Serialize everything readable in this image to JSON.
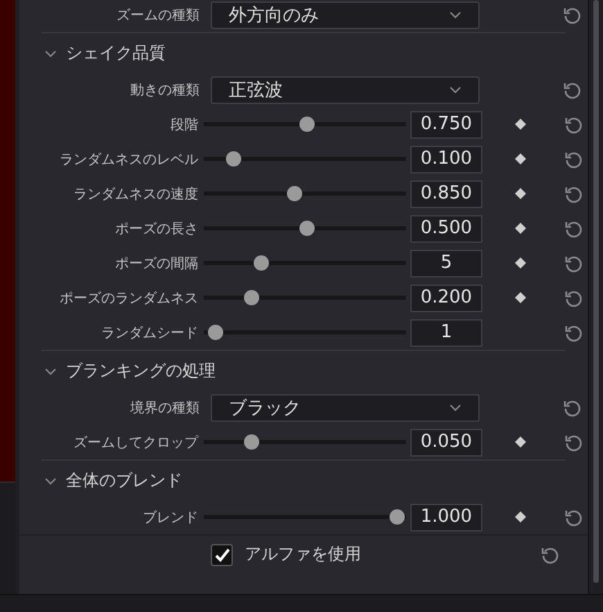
{
  "top_row": {
    "kind": "dropdown",
    "label": "ズームの種類",
    "value": "外方向のみ"
  },
  "sections": [
    {
      "title": "シェイク品質",
      "expanded": true,
      "rows": [
        {
          "kind": "dropdown",
          "label": "動きの種類",
          "value": "正弦波"
        },
        {
          "kind": "slider",
          "label": "段階",
          "level": 0.5,
          "value": "0.750",
          "keyframe": true
        },
        {
          "kind": "slider",
          "label": "ランダムネスのレベル",
          "level": 0.1,
          "value": "0.100",
          "keyframe": true
        },
        {
          "kind": "slider",
          "label": "ランダムネスの速度",
          "level": 0.43,
          "value": "0.850",
          "keyframe": true
        },
        {
          "kind": "slider",
          "label": "ポーズの長さ",
          "level": 0.5,
          "value": "0.500",
          "keyframe": true
        },
        {
          "kind": "slider",
          "label": "ポーズの間隔",
          "level": 0.25,
          "value": "5",
          "keyframe": true
        },
        {
          "kind": "slider",
          "label": "ポーズのランダムネス",
          "level": 0.2,
          "value": "0.200",
          "keyframe": true
        },
        {
          "kind": "slider",
          "label": "ランダムシード",
          "level": 0,
          "value": "1",
          "keyframe": false
        }
      ]
    },
    {
      "title": "ブランキングの処理",
      "expanded": true,
      "rows": [
        {
          "kind": "dropdown",
          "label": "境界の種類",
          "value": "ブラック"
        },
        {
          "kind": "slider",
          "label": "ズームしてクロップ",
          "level": 0.2,
          "value": "0.050",
          "keyframe": true
        }
      ]
    },
    {
      "title": "全体のブレンド",
      "expanded": true,
      "rows": [
        {
          "kind": "slider",
          "label": "ブレンド",
          "level": 1,
          "value": "1.000",
          "keyframe": true
        }
      ]
    }
  ],
  "alpha": {
    "label": "アルファを使用",
    "checked": true
  }
}
